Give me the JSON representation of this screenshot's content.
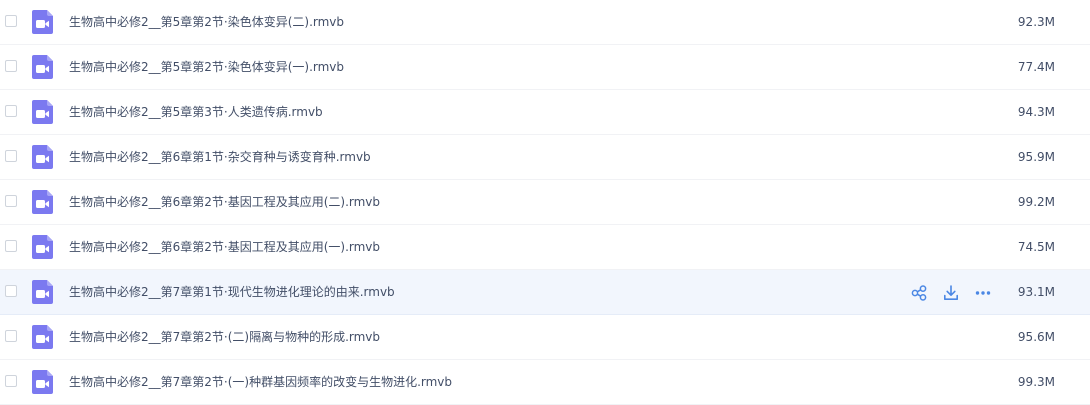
{
  "colors": {
    "accent": "#4b87e4",
    "icon_purple": "#7b79f0",
    "hover_row": "#f2f6fd",
    "text": "#424e67"
  },
  "files": [
    {
      "name": "生物高中必修2__第5章第2节·染色体变异(二).rmvb",
      "size": "92.3M",
      "icon": "video-file-icon"
    },
    {
      "name": "生物高中必修2__第5章第2节·染色体变异(一).rmvb",
      "size": "77.4M",
      "icon": "video-file-icon"
    },
    {
      "name": "生物高中必修2__第5章第3节·人类遗传病.rmvb",
      "size": "94.3M",
      "icon": "video-file-icon"
    },
    {
      "name": "生物高中必修2__第6章第1节·杂交育种与诱变育种.rmvb",
      "size": "95.9M",
      "icon": "video-file-icon"
    },
    {
      "name": "生物高中必修2__第6章第2节·基因工程及其应用(二).rmvb",
      "size": "99.2M",
      "icon": "video-file-icon"
    },
    {
      "name": "生物高中必修2__第6章第2节·基因工程及其应用(一).rmvb",
      "size": "74.5M",
      "icon": "video-file-icon"
    },
    {
      "name": "生物高中必修2__第7章第1节·现代生物进化理论的由来.rmvb",
      "size": "93.1M",
      "icon": "video-file-icon",
      "hovered": true
    },
    {
      "name": "生物高中必修2__第7章第2节·(二)隔离与物种的形成.rmvb",
      "size": "95.6M",
      "icon": "video-file-icon"
    },
    {
      "name": "生物高中必修2__第7章第2节·(一)种群基因频率的改变与生物进化.rmvb",
      "size": "99.3M",
      "icon": "video-file-icon"
    }
  ],
  "row_actions": [
    "share-icon",
    "download-icon",
    "more-icon"
  ]
}
